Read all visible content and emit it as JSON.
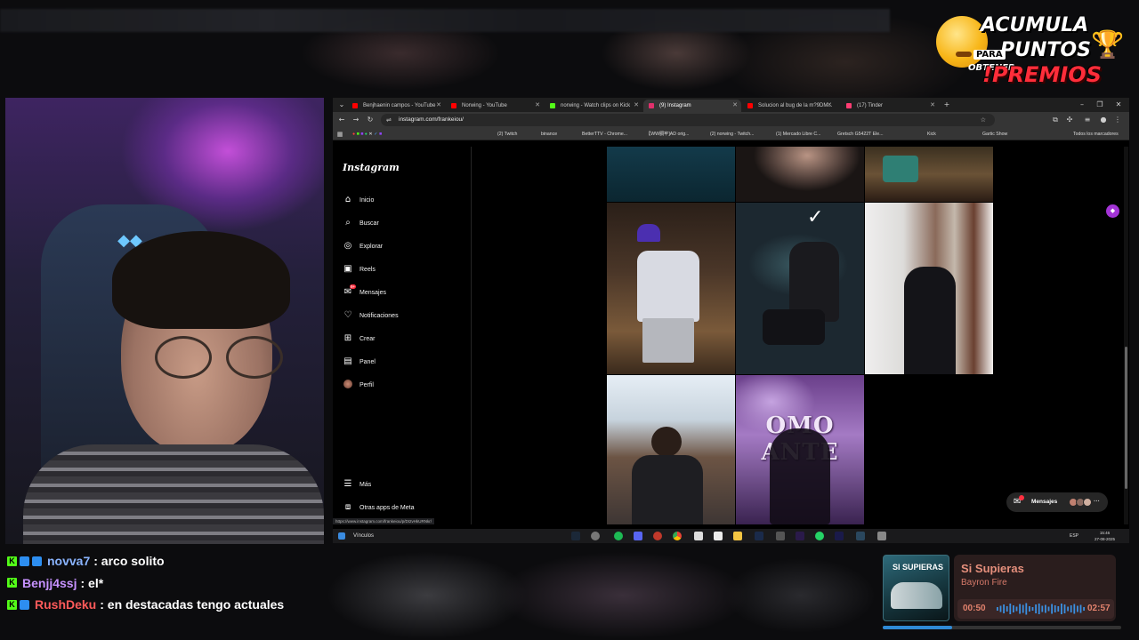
{
  "promo": {
    "line1": "ACUMULA",
    "para": "PARA",
    "line2": "PUNTOS",
    "obtener": "OBTENER",
    "line3": "!PREMIOS"
  },
  "chat": [
    {
      "user": "novva7",
      "color": "#8ab4ff",
      "message": ": arco solito"
    },
    {
      "user": "Benjj4ssj",
      "color": "#c792ff",
      "message": ": el*"
    },
    {
      "user": "RushDeku",
      "color": "#ff5a5a",
      "message": ": en destacadas tengo actuales"
    }
  ],
  "browser": {
    "tabs": [
      {
        "label": "Benjhaenin campos - YouTube",
        "color": "#ff0000",
        "active": false
      },
      {
        "label": "Norwing - YouTube",
        "color": "#ff0000",
        "active": false
      },
      {
        "label": "norwing - Watch clips on Kick",
        "color": "#53fc18",
        "active": false
      },
      {
        "label": "(9) Instagram",
        "color": "#e1306c",
        "active": true
      },
      {
        "label": "Solucion al bug de la m?9DM...",
        "color": "#ff0000",
        "active": false
      },
      {
        "label": "(17) Tinder",
        "color": "#fe3c72",
        "active": false
      }
    ],
    "url": "instagram.com/frankeiou/",
    "bookmarks": [
      "(2) Twitch",
      "binance",
      "BetterTTV - Chrome...",
      "【WW胴牢]AD orig...",
      "(2) norwing - Twitch...",
      "(1) Mercado Libre C...",
      "Gretsch G5422T Ele...",
      "Kick",
      "Gartic Show",
      "Todos los marcadores"
    ]
  },
  "instagram": {
    "logo": "Instagram",
    "nav": [
      {
        "label": "Inicio",
        "icon": "home-icon"
      },
      {
        "label": "Buscar",
        "icon": "search-icon"
      },
      {
        "label": "Explorar",
        "icon": "compass-icon"
      },
      {
        "label": "Reels",
        "icon": "reels-icon"
      },
      {
        "label": "Mensajes",
        "icon": "messenger-icon",
        "badge": "9+"
      },
      {
        "label": "Notificaciones",
        "icon": "heart-icon"
      },
      {
        "label": "Crear",
        "icon": "plus-square-icon"
      },
      {
        "label": "Panel",
        "icon": "dashboard-icon"
      },
      {
        "label": "Perfil",
        "icon": "avatar-icon"
      }
    ],
    "more": "Más",
    "meta": "Otras apps de Meta",
    "messages_pill": "Mensajes",
    "grid_post_text": "OMO ANTE",
    "status_url": "https://www.instagram.com/frankeiou/p/DI2vHkURNkr/"
  },
  "taskbar": {
    "vinculos": "Vínculos",
    "lang": "ESP",
    "time": "15:46",
    "date": "27-08-2025"
  },
  "music": {
    "album_text": "SI SUPIERAS",
    "title": "Si Supieras",
    "artist": "Bayron Fire",
    "current": "00:50",
    "total": "02:57",
    "progress": 0.29
  }
}
